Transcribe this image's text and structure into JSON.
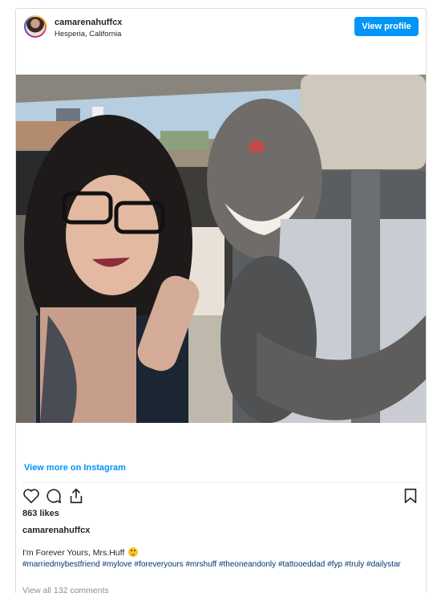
{
  "post": {
    "username": "camarenahuffcx",
    "location": "Hesperia, California",
    "view_profile_label": "View profile",
    "photo_label": "Selfie of a couple in a car",
    "view_more_label": "View more on Instagram",
    "likes": "863 likes",
    "caption_username": "camarenahuffcx",
    "caption_text": "I'm Forever Yours, Mrs.Huff",
    "hashtags": [
      "#marriedmybestfriend",
      "#mylove",
      "#foreveryours",
      "#mrshuff",
      "#theoneandonly",
      "#tattooeddad",
      "#fyp",
      "#truly",
      "#dailystar"
    ],
    "comments_label": "View all 132 comments"
  },
  "icons": [
    "heart-icon",
    "comment-icon",
    "share-icon",
    "bookmark-icon",
    "wink-emoji-icon"
  ],
  "colors": {
    "accent": "#0095f6",
    "hashtag": "#00376b",
    "muted": "#8e8e8e",
    "border": "#dbdbdb"
  }
}
